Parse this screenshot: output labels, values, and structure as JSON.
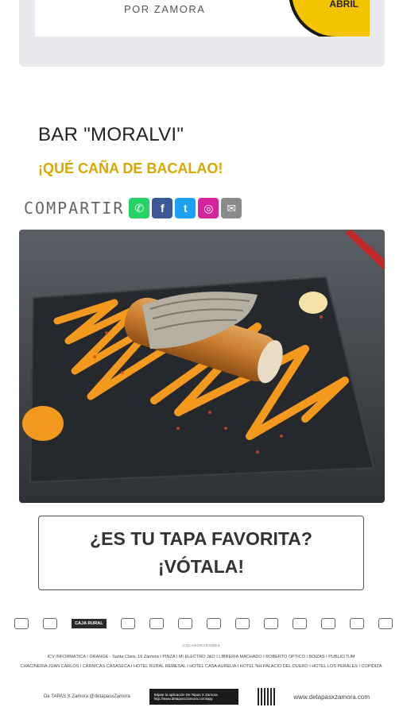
{
  "banner": {
    "logo_text": "POR ZAMORA",
    "badge_text": "ABRIL"
  },
  "bar": {
    "title": "BAR \"MORALVI\"",
    "tapa_name": "¡QUÉ CAÑA DE BACALAO!"
  },
  "share": {
    "label": "COMPARTIR",
    "buttons": [
      {
        "name": "whatsapp-icon",
        "color": "#25d366",
        "glyph": "✆"
      },
      {
        "name": "facebook-icon",
        "color": "#3b5998",
        "glyph": "f"
      },
      {
        "name": "twitter-icon",
        "color": "#1da1f2",
        "glyph": "t"
      },
      {
        "name": "instagram-icon",
        "color": "#d6249f",
        "glyph": "◎"
      },
      {
        "name": "email-icon",
        "color": "#8a8a8a",
        "glyph": "✉"
      }
    ]
  },
  "vote": {
    "line1": "¿ES TU TAPA FAVORITA?",
    "line2": "¡VÓTALA!"
  },
  "sponsors": [
    "",
    "",
    "CAJA RURAL",
    "",
    "",
    "",
    "",
    "",
    "",
    "",
    "",
    "",
    ""
  ],
  "collaborators": {
    "title": "COLABORADORES",
    "line1": "ICV INFORMÁTICA  I  ORANGE - Santa Clara, 16 Zamora  I  PINZA  I  MI ELECTRO J&O  I  LIBRERIA MACHADO  I  ROBERTO ÓPTICO  I  BOIZAS  I  PUBLICITUM",
    "line2": "CHACINERIA JUAN CARLOS  I  CARNICAS CASASECA  I  HOTEL RURAL REMESAL  I  HOTEL CASA AURELIA  I  HOTEL NH PALACIO DEL DUERO  I  HOTEL LOS PERALES  I  COPIDIZA"
  },
  "footer": {
    "social": "De TAPAS X Zamora  @detapasxZamora",
    "app_line1": "Bájate la aplicación De Tapas X Zamora",
    "app_line2": "http://www.detapasxzamora.com/app",
    "website": "www.detapasxzamora.com"
  }
}
